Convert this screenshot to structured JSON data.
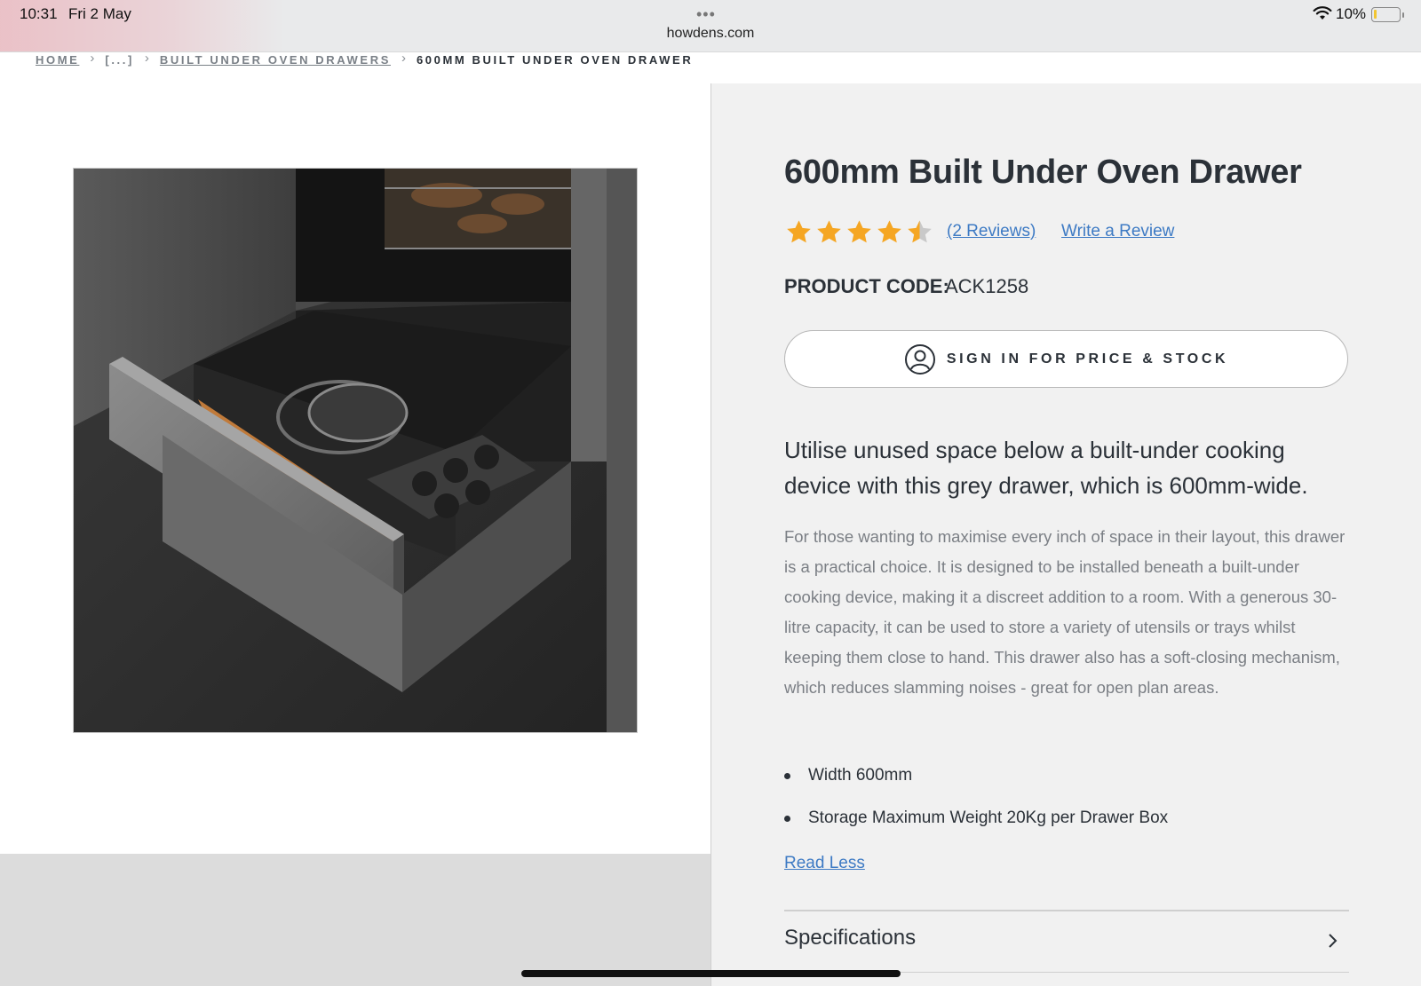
{
  "status_bar": {
    "time": "10:31",
    "date": "Fri 2 May",
    "url": "howdens.com",
    "battery": "10%",
    "more_dots": "•••",
    "icons": [
      "wifi-icon",
      "battery-icon"
    ]
  },
  "breadcrumb": {
    "home": "HOME",
    "ellipsis": "[...]",
    "category": "BUILT UNDER OVEN DRAWERS",
    "current": "600MM BUILT UNDER OVEN DRAWER",
    "separator": "›"
  },
  "product": {
    "title": "600mm Built Under Oven Drawer",
    "rating": 4.5,
    "rating_max": 5,
    "reviews_link": "(2 Reviews)",
    "write_review": "Write a Review",
    "code_label": "PRODUCT CODE:",
    "code_value": "ACK1258",
    "signin_label": "SIGN IN FOR PRICE & STOCK",
    "lead": "Utilise unused space below a built-under cooking device with this grey drawer, which is 600mm-wide.",
    "description": "For those wanting to maximise every inch of space in their layout, this drawer is a practical choice. It is designed to be installed beneath a built-under cooking device, making it a discreet addition to a room. With a generous 30-litre capacity, it can be used to store a variety of utensils or trays whilst keeping them close to hand. This drawer also has a soft-closing mechanism, which reduces slamming noises - great for open plan areas.",
    "features": [
      "Width 600mm",
      "Storage Maximum Weight 20Kg per Drawer Box"
    ],
    "read_less": "Read Less",
    "specifications": "Specifications"
  },
  "colors": {
    "star": "#f5a623",
    "star_empty": "#c9c9c9",
    "link": "#3d7ac4",
    "text": "#2b3138",
    "muted": "#7b7f85",
    "panel_bg": "#f1f1f1"
  }
}
